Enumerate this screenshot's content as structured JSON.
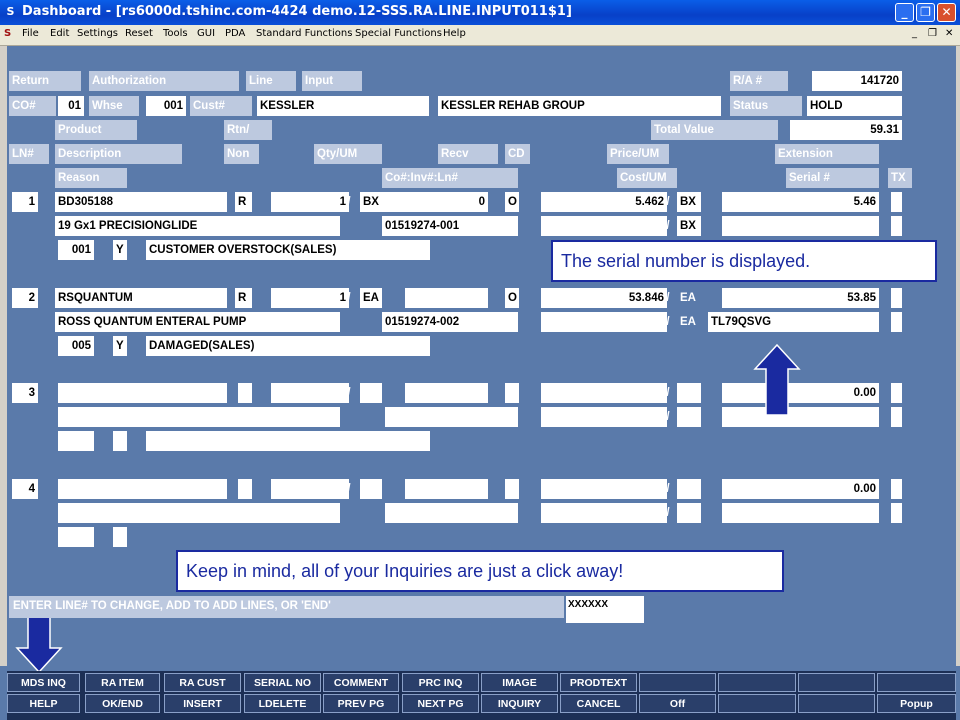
{
  "window": {
    "title": "Dashboard - [rs6000d.tshinc.com-4424 demo.12-SSS.RA.LINE.INPUT011$1]",
    "app_icon": "S"
  },
  "menu": [
    "File",
    "Edit",
    "Settings",
    "Reset",
    "Tools",
    "GUI",
    "PDA",
    "Standard Functions",
    "Special Functions",
    "Help"
  ],
  "header": {
    "return_label": "Return",
    "authorization_label": "Authorization",
    "line_label": "Line",
    "input_label": "Input",
    "ra_label": "R/A #",
    "ra_value": "141720",
    "co_label": "CO#",
    "co_value": "01",
    "whse_label": "Whse",
    "whse_value": "001",
    "cust_label": "Cust#",
    "cust_value": "KESSLER",
    "cust_name": "KESSLER REHAB GROUP",
    "status_label": "Status",
    "status_value": "HOLD",
    "product_label": "Product",
    "rtn_label": "Rtn/",
    "total_label": "Total Value",
    "total_value": "59.31"
  },
  "columns": {
    "ln": "LN#",
    "description": "Description",
    "non": "Non",
    "qty": "Qty/UM",
    "recv": "Recv",
    "cd": "CD",
    "price": "Price/UM",
    "extension": "Extension",
    "reason": "Reason",
    "coinv": "Co#:Inv#:Ln#",
    "cost": "Cost/UM",
    "serial": "Serial #",
    "tx": "TX"
  },
  "lines": [
    {
      "ln": "1",
      "product": "BD305188",
      "non": "R",
      "qty": "1",
      "um": "BX",
      "recv": "0",
      "cd": "O",
      "price": "5.462",
      "price_um": "BX",
      "extension": "5.46",
      "description": "19 Gx1 PRECISIONGLIDE",
      "coinv": "01519274-001",
      "cost_um": "BX",
      "serial": "",
      "reason_code": "001",
      "reason_flag": "Y",
      "reason": "CUSTOMER OVERSTOCK(SALES)"
    },
    {
      "ln": "2",
      "product": "RSQUANTUM",
      "non": "R",
      "qty": "1",
      "um": "EA",
      "recv": "",
      "cd": "O",
      "price": "53.846",
      "price_um": "EA",
      "extension": "53.85",
      "description": "ROSS QUANTUM ENTERAL PUMP",
      "coinv": "01519274-002",
      "cost_um": "EA",
      "serial": "TL79QSVG",
      "reason_code": "005",
      "reason_flag": "Y",
      "reason": "DAMAGED(SALES)"
    },
    {
      "ln": "3",
      "product": "",
      "non": "",
      "qty": "",
      "um": "",
      "recv": "",
      "cd": "",
      "price": "",
      "price_um": "",
      "extension": "0.00",
      "description": "",
      "coinv": "",
      "cost_um": "",
      "serial": "",
      "reason_code": "",
      "reason_flag": "",
      "reason": ""
    },
    {
      "ln": "4",
      "product": "",
      "non": "",
      "qty": "",
      "um": "",
      "recv": "",
      "cd": "",
      "price": "",
      "price_um": "",
      "extension": "0.00",
      "description": "",
      "coinv": "",
      "cost_um": "",
      "serial": "",
      "reason_code": "",
      "reason_flag": "",
      "reason": ""
    }
  ],
  "callouts": {
    "serial": "The serial number is displayed.",
    "inquiries": "Keep in mind, all of your Inquiries are just a click away!"
  },
  "prompt": {
    "text": "ENTER LINE# TO CHANGE, ADD TO ADD LINES, OR 'END'",
    "value": "XXXXXX"
  },
  "fkeys_top": [
    "MDS INQ",
    "RA ITEM",
    "RA CUST",
    "SERIAL NO",
    "COMMENT",
    "PRC INQ",
    "IMAGE",
    "PRODTEXT",
    "",
    "",
    "",
    "",
    ""
  ],
  "fkeys_bottom": [
    "HELP",
    "OK/END",
    "INSERT",
    "LDELETE",
    "PREV PG",
    "NEXT PG",
    "INQUIRY",
    "CANCEL",
    "Off",
    "",
    "",
    "",
    "Popup"
  ],
  "slash": "/",
  "colors": {
    "background": "#5a7aaa",
    "label": "#bdc9df",
    "callout_border": "#1a2aa0",
    "arrow": "#1a2aa0"
  }
}
